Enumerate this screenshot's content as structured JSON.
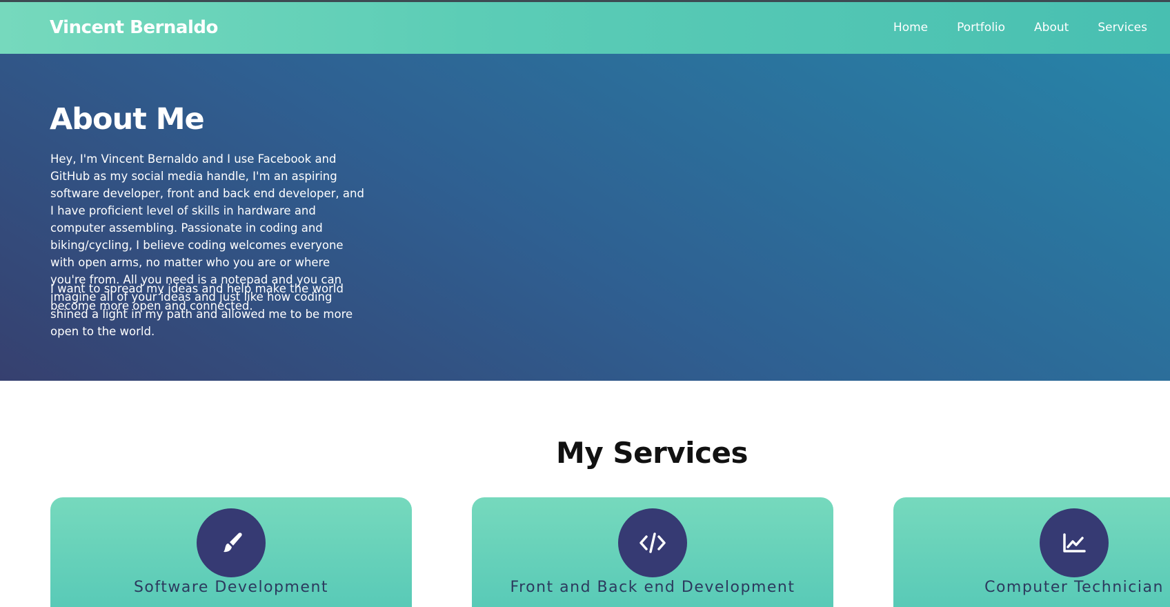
{
  "navbar": {
    "brand": "Vincent Bernaldo",
    "links": [
      "Home",
      "Portfolio",
      "About",
      "Services"
    ]
  },
  "about": {
    "title": "About Me",
    "paragraph1": "Hey, I'm Vincent Bernaldo and I use Facebook and GitHub as my social media handle, I'm an aspiring software developer, front and back end developer, and I have proficient level of skills in hardware and computer assembling. Passionate in coding and biking/cycling, I believe coding welcomes everyone with open arms, no matter who you are or where you're from. All you need is a notepad and you can imagine all of your ideas and just like how coding shined a light in my path and allowed me to be more open to the world.",
    "paragraph2": "I want to spread my ideas and help make the world become more open and connected."
  },
  "services": {
    "title": "My Services",
    "cards": [
      {
        "title": "Software Development",
        "icon": "paintbrush-icon"
      },
      {
        "title": "Front and Back end Development",
        "icon": "code-icon"
      },
      {
        "title": "Computer Technician",
        "icon": "line-chart-icon"
      }
    ]
  },
  "colors": {
    "nav_gradient_start": "#76d9bd",
    "nav_gradient_end": "#48bfb1",
    "hero_gradient_start": "#36406f",
    "hero_gradient_end": "#2784a8",
    "icon_circle": "#363a73"
  }
}
